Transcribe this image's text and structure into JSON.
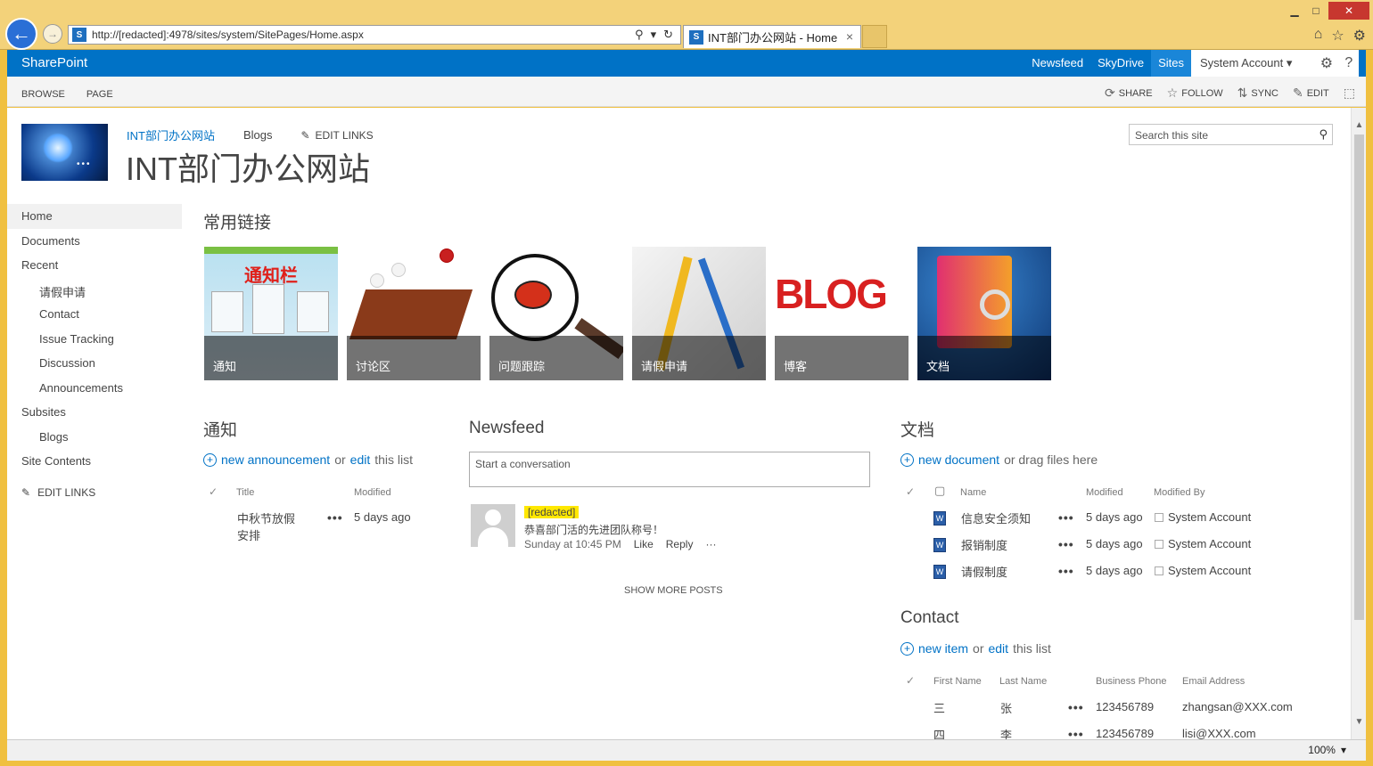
{
  "browser": {
    "url": "http://[redacted]:4978/sites/system/SitePages/Home.aspx",
    "tab_title": "INT部门办公网站 - Home",
    "tab_close": "×",
    "back_glyph": "←",
    "forward_glyph": "→",
    "min_glyph": "▁",
    "max_glyph": "□",
    "close_glyph": "✕",
    "address_search_glyph": "⚲",
    "address_dropdown_glyph": "▾",
    "address_refresh_glyph": "↻",
    "home_glyph": "⌂",
    "favorites_glyph": "☆",
    "settings_glyph": "⚙",
    "favicon_letter": "S",
    "zoom_label": "100%",
    "zoom_caret": "▾"
  },
  "suite": {
    "brand": "SharePoint",
    "links": [
      "Newsfeed",
      "SkyDrive",
      "Sites"
    ],
    "active_link": "Sites",
    "account": "System Account ▾",
    "gear_glyph": "⚙",
    "help_glyph": "?"
  },
  "ribbon": {
    "tabs": [
      "BROWSE",
      "PAGE"
    ],
    "share": "SHARE",
    "follow": "FOLLOW",
    "sync": "SYNC",
    "edit": "EDIT",
    "share_glyph": "⟳",
    "follow_glyph": "☆",
    "sync_glyph": "⇅",
    "edit_glyph": "✎",
    "focus_glyph": "⬚"
  },
  "site": {
    "link": "INT部门办公网站",
    "blogs": "Blogs",
    "edit_links": "EDIT LINKS",
    "edit_glyph": "✎",
    "title": "INT部门办公网站",
    "search_placeholder": "Search this site",
    "search_glyph": "⚲",
    "logo_dots": "•••"
  },
  "quicklaunch": {
    "items": [
      "Home",
      "Documents",
      "Recent",
      "请假申请",
      "Contact",
      "Issue Tracking",
      "Discussion",
      "Announcements",
      "Subsites",
      "Blogs",
      "Site Contents"
    ],
    "edit_links": "EDIT LINKS"
  },
  "links": {
    "title": "常用链接",
    "tiles": [
      "通知",
      "讨论区",
      "问题跟踪",
      "请假申请",
      "博客",
      "文档"
    ],
    "tile1_word": "通知栏",
    "tile5_word": "BLOG"
  },
  "announcements": {
    "title": "通知",
    "new_link": "new announcement",
    "or": "or",
    "edit": "edit",
    "this_list": "this list",
    "col_title": "Title",
    "col_modified": "Modified",
    "row_title": "中秋节放假安排",
    "row_modified": "5 days ago"
  },
  "newsfeed": {
    "title": "Newsfeed",
    "placeholder": "Start a conversation",
    "poster": "[redacted]",
    "post_text": "恭喜部门活的先进团队称号！",
    "post_time": "Sunday at 10:45 PM",
    "like": "Like",
    "reply": "Reply",
    "more": "···",
    "show_more": "SHOW MORE POSTS"
  },
  "documents": {
    "title": "文档",
    "new_link": "new document",
    "drag_text": "or drag files here",
    "col_name": "Name",
    "col_modified": "Modified",
    "col_modified_by": "Modified By",
    "rows": [
      {
        "name": "信息安全须知",
        "modified": "5 days ago",
        "by": "System Account"
      },
      {
        "name": "报销制度",
        "modified": "5 days ago",
        "by": "System Account"
      },
      {
        "name": "请假制度",
        "modified": "5 days ago",
        "by": "System Account"
      }
    ]
  },
  "contact": {
    "title": "Contact",
    "new_link": "new item",
    "or": "or",
    "edit": "edit",
    "this_list": "this list",
    "col_first": "First Name",
    "col_last": "Last Name",
    "col_phone": "Business Phone",
    "col_email": "Email Address",
    "rows": [
      {
        "first": "三",
        "last": "张",
        "phone": "123456789",
        "email": "zhangsan@XXX.com"
      },
      {
        "first": "四",
        "last": "李",
        "phone": "123456789",
        "email": "lisi@XXX.com"
      }
    ]
  },
  "common": {
    "ellipsis": "•••",
    "check": "✓",
    "plus": "+",
    "doc_glyph": "W"
  }
}
